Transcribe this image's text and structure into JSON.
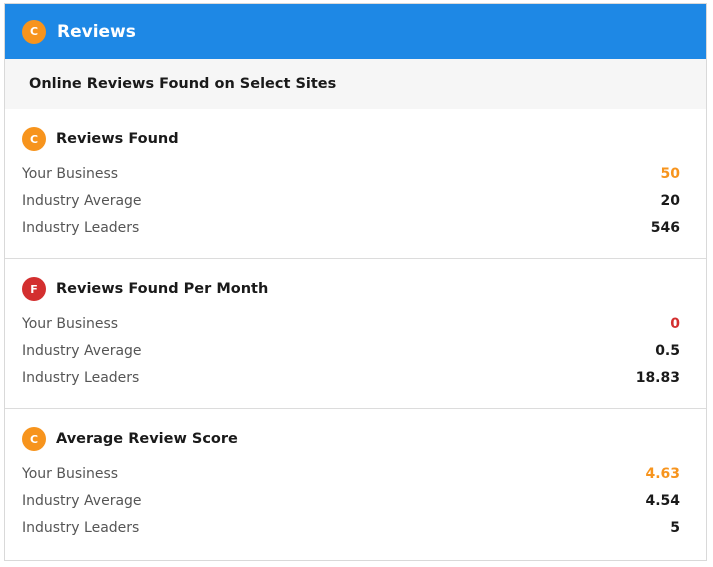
{
  "colors": {
    "header_bg": "#1e88e5",
    "grade_c": "#f7941d",
    "grade_f": "#d32f2f",
    "value_default": "#1a1a1a"
  },
  "header": {
    "grade": "C",
    "title": "Reviews"
  },
  "subheader": {
    "title": "Online Reviews Found on Select Sites"
  },
  "sections": [
    {
      "grade": "C",
      "title": "Reviews Found",
      "rows": [
        {
          "label": "Your Business",
          "value": "50"
        },
        {
          "label": "Industry Average",
          "value": "20"
        },
        {
          "label": "Industry Leaders",
          "value": "546"
        }
      ]
    },
    {
      "grade": "F",
      "title": "Reviews Found Per Month",
      "rows": [
        {
          "label": "Your Business",
          "value": "0"
        },
        {
          "label": "Industry Average",
          "value": "0.5"
        },
        {
          "label": "Industry Leaders",
          "value": "18.83"
        }
      ]
    },
    {
      "grade": "C",
      "title": "Average Review Score",
      "rows": [
        {
          "label": "Your Business",
          "value": "4.63"
        },
        {
          "label": "Industry Average",
          "value": "4.54"
        },
        {
          "label": "Industry Leaders",
          "value": "5"
        }
      ]
    }
  ]
}
